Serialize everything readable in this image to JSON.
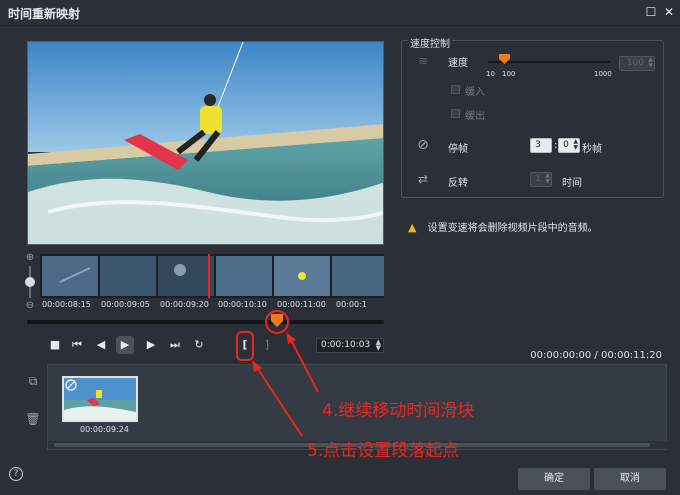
{
  "window": {
    "title": "时间重新映射",
    "maximize_icon": "maximize-icon",
    "close_icon": "close-icon"
  },
  "timeline": {
    "timecodes": [
      "00:00:08:15",
      "00:00:09:05",
      "00:00:09:20",
      "00:00:10:10",
      "00:00:11:00",
      "00:00:1"
    ]
  },
  "player": {
    "current_time": "0:00:10:03",
    "duration_readout": "00:00:00:00 / 00:00:11:20",
    "mark_in_label": "[",
    "mark_out_label": "]"
  },
  "speed_control": {
    "legend": "速度控制",
    "speed_label": "速度",
    "speed_min": "10",
    "speed_default": "100",
    "speed_max": "1000",
    "speed_value": "100",
    "ease_in_label": "缓入",
    "ease_out_label": "缓出",
    "freeze_label": "停帧",
    "freeze_seconds": "3",
    "freeze_frames": "0",
    "freeze_unit": "秒帧",
    "reverse_label": "反转",
    "reverse_value": "1",
    "reverse_unit": "时间"
  },
  "warning": "设置变速将会删除视频片段中的音频。",
  "clip_bin": {
    "clip_time": "00:00:09:24"
  },
  "annotations": {
    "step4": "4.继续移动时间滑块",
    "step5": "5.点击设置段落起点",
    "color": "#e8281e"
  },
  "buttons": {
    "ok": "确定",
    "cancel": "取消",
    "help": "?"
  }
}
